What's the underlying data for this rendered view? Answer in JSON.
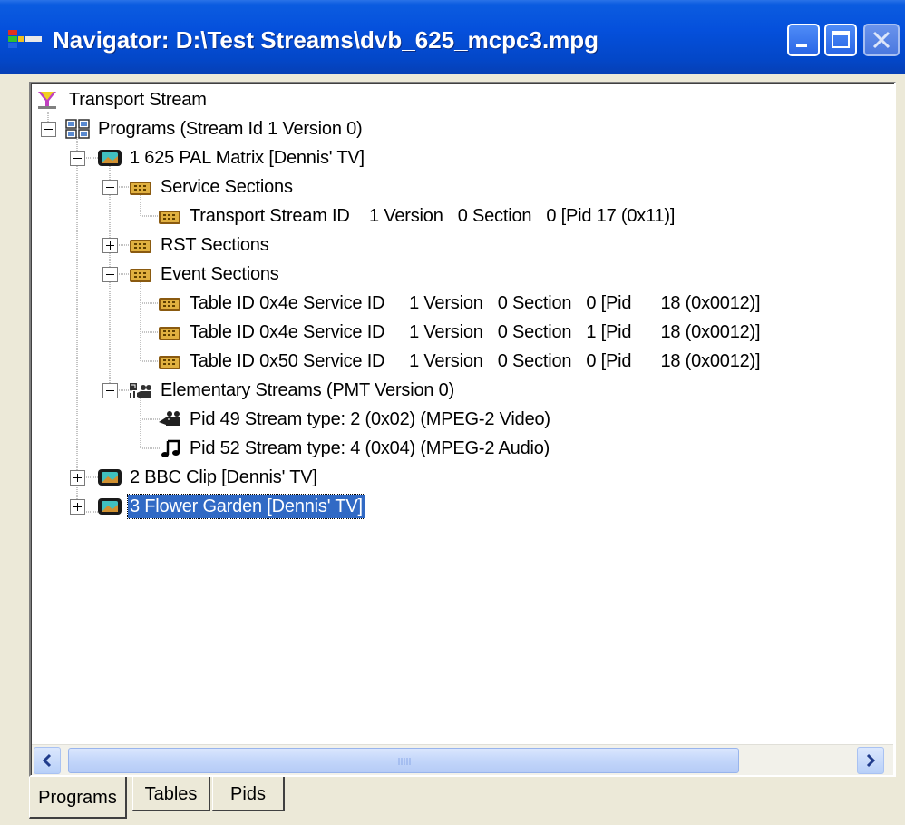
{
  "window": {
    "title": "Navigator: D:\\Test Streams\\dvb_625_mcpc3.mpg",
    "buttons": [
      "minimize",
      "maximize",
      "close"
    ]
  },
  "tree": {
    "root": "Transport Stream",
    "programs": "Programs (Stream Id 1 Version 0)",
    "program1": "1 625 PAL Matrix [Dennis' TV]",
    "service_sections": "Service Sections",
    "ts_id": "Transport Stream ID    1 Version   0 Section   0 [Pid 17 (0x11)]",
    "rst_sections": "RST Sections",
    "event_sections": "Event Sections",
    "event1": "Table ID 0x4e Service ID     1 Version   0 Section   0 [Pid      18 (0x0012)]",
    "event2": "Table ID 0x4e Service ID     1 Version   0 Section   1 [Pid      18 (0x0012)]",
    "event3": "Table ID 0x50 Service ID     1 Version   0 Section   0 [Pid      18 (0x0012)]",
    "elementary_streams": "Elementary Streams (PMT Version 0)",
    "video_pid": "Pid 49 Stream type: 2 (0x02) (MPEG-2 Video)",
    "audio_pid": "Pid 52 Stream type: 4 (0x04) (MPEG-2 Audio)",
    "program2": "2 BBC Clip [Dennis' TV]",
    "program3": "3 Flower Garden [Dennis' TV]"
  },
  "tabs": [
    "Programs",
    "Tables",
    "Pids"
  ],
  "active_tab": "Programs",
  "colors": {
    "titlebar": "#0550dc",
    "selection": "#316ac5",
    "window_bg": "#ece9d8"
  }
}
